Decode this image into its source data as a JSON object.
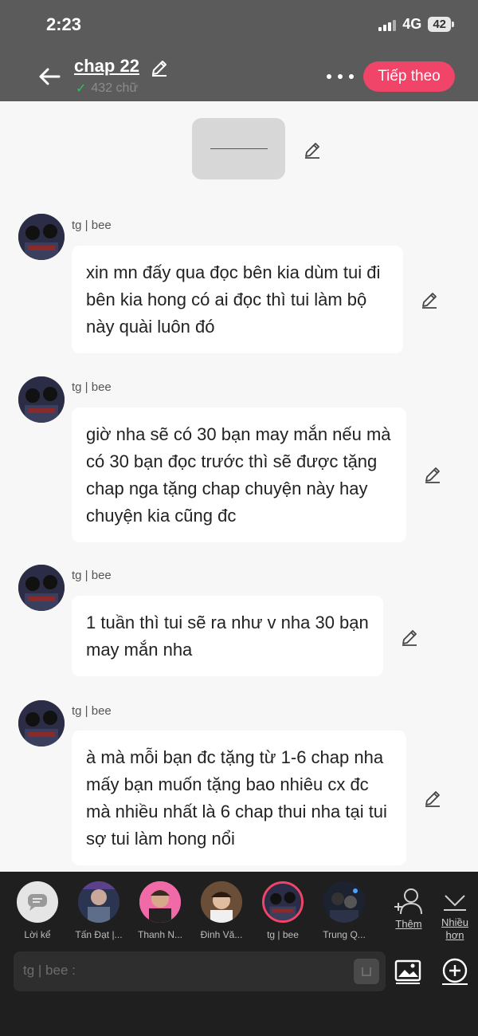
{
  "status": {
    "time": "2:23",
    "network": "4G",
    "battery": "42"
  },
  "header": {
    "title": "chap 22",
    "word_count": "432 chữ",
    "next_label": "Tiếp theo"
  },
  "messages": [
    {
      "sender": "tg | bee",
      "text": "xin mn đấy qua đọc bên kia dùm tui đi bên kia hong có ai đọc thì tui làm bộ này quài luôn đó"
    },
    {
      "sender": "tg | bee",
      "text": "giờ nha sẽ có 30 bạn may mắn nếu mà có 30 bạn đọc trước thì sẽ được tặng chap nga tặng chap chuyện này hay chuyện kia cũng đc"
    },
    {
      "sender": "tg | bee",
      "text": "1 tuần thì tui sẽ ra như v nha 30 bạn may mắn nha"
    },
    {
      "sender": "tg | bee",
      "text": "à mà mỗi bạn đc tặng từ 1-6 chap nha mấy bạn muốn tặng bao nhiêu cx đc mà nhiều nhất là 6 chap thui nha tại tui sợ tui làm hong nổi"
    }
  ],
  "characters": [
    {
      "name": "Lời kể",
      "icon": "narrator-icon"
    },
    {
      "name": "Tấn Đạt |..."
    },
    {
      "name": "Thanh N..."
    },
    {
      "name": "Đinh Vă..."
    },
    {
      "name": "tg | bee"
    },
    {
      "name": "Trung Q..."
    }
  ],
  "bottom": {
    "add_more": "Thêm",
    "more": "Nhiều hơn",
    "input_placeholder": "tg | bee :"
  },
  "colors": {
    "accent": "#f04468",
    "header_bg": "#5b5b5b",
    "bottom_bg": "#1f1f1f"
  }
}
